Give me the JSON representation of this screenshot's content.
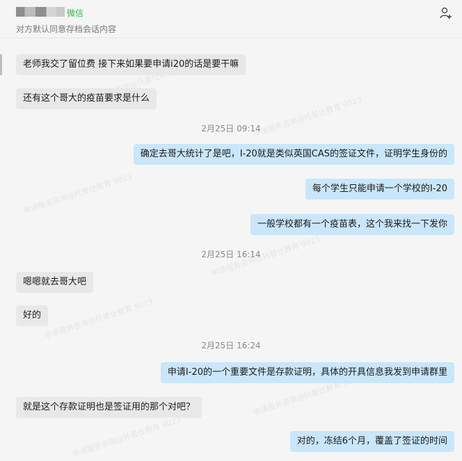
{
  "header": {
    "wechat_tag": "微信",
    "subtitle": "对方默认同意存档会话内容"
  },
  "messages": {
    "m1": "老师我交了留位费 接下来如果要申请i20的话是要干嘛",
    "m2": "还有这个哥大的疫苗要求是什么",
    "t1": "2月25日 09:14",
    "m3": "确定去哥大统计了是吧，I-20就是类似英国CAS的签证文件，证明学生身份的",
    "m4": "每个学生只能申请一个学校的I-20",
    "m5": "一般学校都有一个疫苗表，这个我来找一下发你",
    "t2": "2月25日 16:14",
    "m6": "嗯嗯就去哥大吧",
    "m7": "好的",
    "t3": "2月25日 16:24",
    "m8": "申请I-20的一个重要文件是存款证明，具体的开具信息我发到申请群里",
    "m9": "就是这个存款证明也是签证用的那个对吧？",
    "m10": "对的，冻结6个月，覆盖了签证的时间"
  },
  "icons": {
    "add_member": "add-user-icon"
  },
  "colors": {
    "incoming_bubble": "#e8e8e8",
    "outgoing_bubble": "#c9e6fb",
    "wechat_green": "#38b04b",
    "background": "#f5f5f5"
  }
}
